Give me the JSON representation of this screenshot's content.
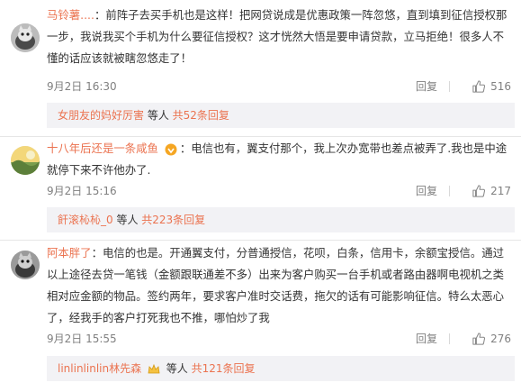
{
  "comments": [
    {
      "username": "马铃薯....",
      "text": "：前阵子去买手机也是这样！把网贷说成是优惠政策一阵忽悠，直到填到征信授权那一步，我说我买个手机为什么要征信授权？这才恍然大悟是要申请贷款，立马拒绝！很多人不懂的话应该就被瞎忽悠走了！",
      "time": "9月2日 16:30",
      "reply_label": "回复",
      "likes": "516",
      "replies_user": "女朋友的妈好厉害",
      "replies_mid": " 等人 ",
      "replies_count": "共52条回复"
    },
    {
      "username": "十八年后还是一条咸鱼",
      "text": "：电信也有，翼支付那个，我上次办宽带也差点被弄了.我也是中途就停下来不许他办了.",
      "time": "9月2日 15:16",
      "reply_label": "回复",
      "likes": "217",
      "replies_user": "飦滚杺杺_0",
      "replies_mid": " 等人 ",
      "replies_count": "共223条回复"
    },
    {
      "username": "阿本胖了",
      "text": "：电信的也是。开通翼支付，分普通授信，花呗，白条，信用卡，余额宝授信。通过以上途径去贷一笔钱（金额跟联通差不多）出来为客户购买一台手机或者路由器啊电视机之类相对应金额的物品。签约两年，要求客户准时交话费，拖欠的话有可能影响征信。特么太恶心了，经我手的客户打死我也不推，哪怕炒了我",
      "time": "9月2日 15:55",
      "reply_label": "回复",
      "likes": "276",
      "replies_user": "linlinlinlin林先森",
      "replies_mid": " 等人 ",
      "replies_count": "共121条回复"
    }
  ],
  "colors": {
    "username": "#eb7350",
    "meta": "#808080",
    "subbg": "#f2f2f5"
  },
  "icons": [
    "avatar-cat",
    "avatar-landscape",
    "avatar-cat-dark",
    "thumbs-up-icon",
    "vip-badge-icon",
    "crown-badge-icon"
  ]
}
